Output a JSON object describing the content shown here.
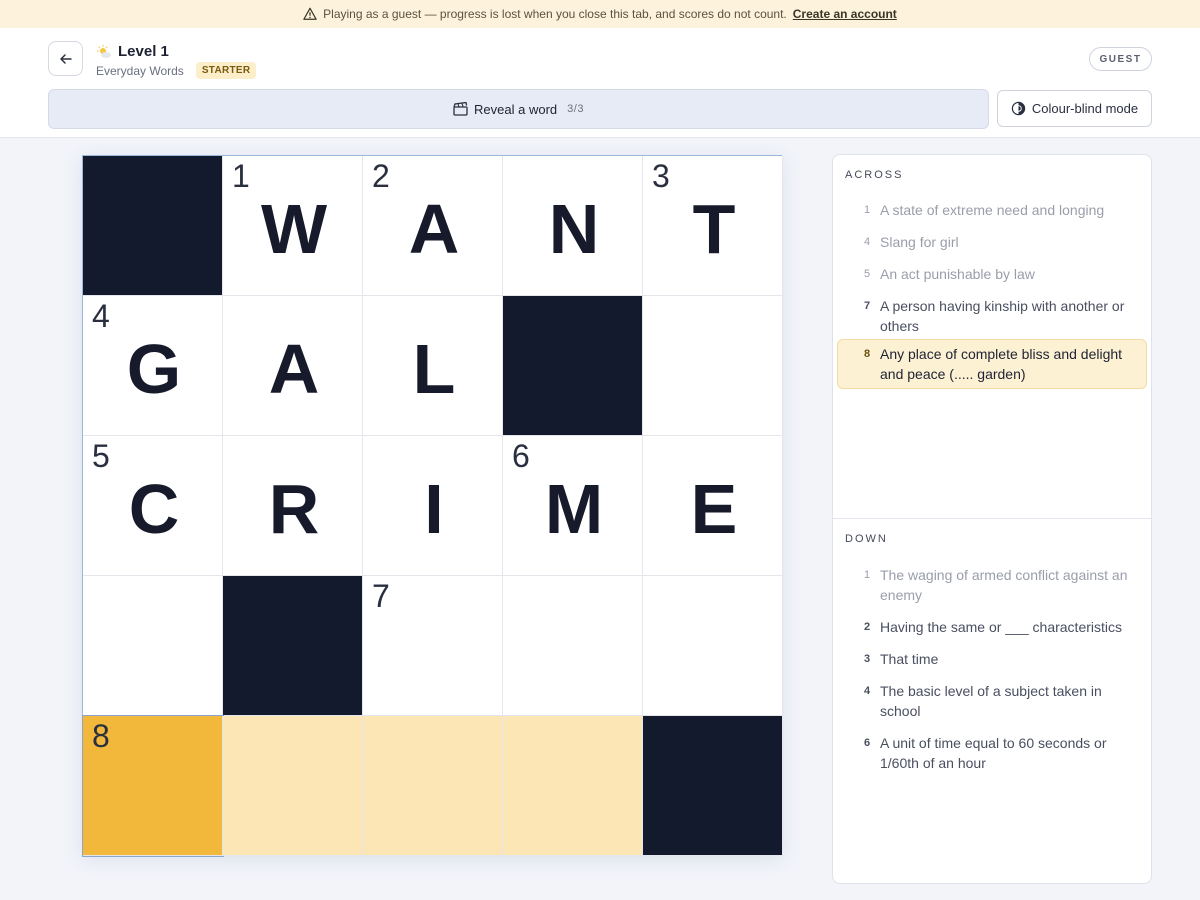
{
  "banner": {
    "message": "Playing as a guest — progress is lost when you close this tab, and scores do not count.",
    "link": "Create an account"
  },
  "header": {
    "level_title": "Level 1",
    "category": "Everyday Words",
    "badge": "STARTER",
    "guest_label": "GUEST"
  },
  "toolbar": {
    "reveal_label": "Reveal a word",
    "reveal_count": "3/3",
    "colour_blind_label": "Colour-blind mode"
  },
  "grid": {
    "cells": [
      {
        "letter": "",
        "number": "",
        "state": "black"
      },
      {
        "letter": "W",
        "number": "1",
        "state": "filled"
      },
      {
        "letter": "A",
        "number": "2",
        "state": "filled"
      },
      {
        "letter": "N",
        "number": "",
        "state": "filled"
      },
      {
        "letter": "T",
        "number": "3",
        "state": "filled"
      },
      {
        "letter": "G",
        "number": "4",
        "state": "filled"
      },
      {
        "letter": "A",
        "number": "",
        "state": "filled"
      },
      {
        "letter": "L",
        "number": "",
        "state": "filled"
      },
      {
        "letter": "",
        "number": "",
        "state": "black"
      },
      {
        "letter": "",
        "number": "",
        "state": "empty"
      },
      {
        "letter": "C",
        "number": "5",
        "state": "filled"
      },
      {
        "letter": "R",
        "number": "",
        "state": "filled"
      },
      {
        "letter": "I",
        "number": "",
        "state": "filled"
      },
      {
        "letter": "M",
        "number": "6",
        "state": "filled"
      },
      {
        "letter": "E",
        "number": "",
        "state": "filled"
      },
      {
        "letter": "",
        "number": "",
        "state": "empty"
      },
      {
        "letter": "",
        "number": "",
        "state": "black"
      },
      {
        "letter": "",
        "number": "7",
        "state": "empty"
      },
      {
        "letter": "",
        "number": "",
        "state": "empty"
      },
      {
        "letter": "",
        "number": "",
        "state": "empty"
      },
      {
        "letter": "",
        "number": "8",
        "state": "active"
      },
      {
        "letter": "",
        "number": "",
        "state": "word"
      },
      {
        "letter": "",
        "number": "",
        "state": "word"
      },
      {
        "letter": "",
        "number": "",
        "state": "word"
      },
      {
        "letter": "",
        "number": "",
        "state": "black"
      }
    ]
  },
  "clues": {
    "across_heading": "ACROSS",
    "down_heading": "DOWN",
    "across": [
      {
        "number": "1",
        "text": "A state of extreme need and longing",
        "status": "solved"
      },
      {
        "number": "4",
        "text": "Slang for girl",
        "status": "solved"
      },
      {
        "number": "5",
        "text": "An act punishable by law",
        "status": "solved"
      },
      {
        "number": "7",
        "text": "A person having kinship with another or others",
        "status": "open"
      },
      {
        "number": "8",
        "text": "Any place of complete bliss and delight and peace (..... garden)",
        "status": "selected"
      }
    ],
    "down": [
      {
        "number": "1",
        "text": "The waging of armed conflict against an enemy",
        "status": "solved"
      },
      {
        "number": "2",
        "text": "Having the same or ___ characteristics",
        "status": "open"
      },
      {
        "number": "3",
        "text": "That time",
        "status": "open"
      },
      {
        "number": "4",
        "text": "The basic level of a subject taken in school",
        "status": "open"
      },
      {
        "number": "6",
        "text": "A unit of time equal to 60 seconds or 1/60th of an hour",
        "status": "open"
      }
    ]
  }
}
